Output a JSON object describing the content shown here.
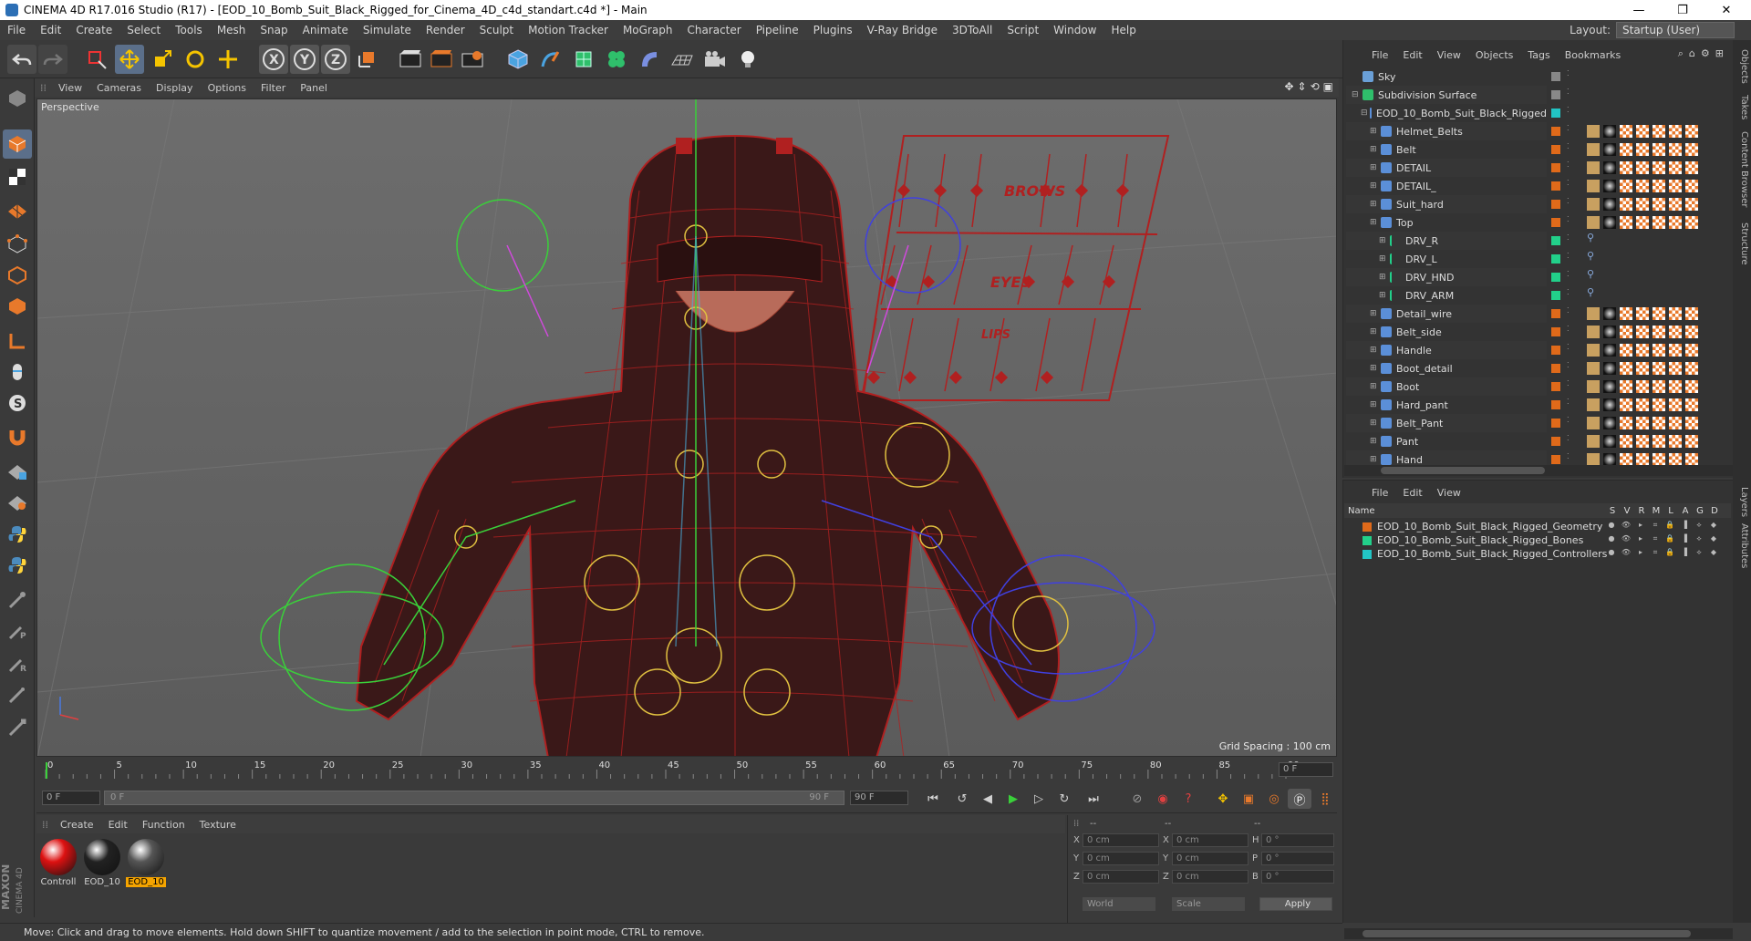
{
  "window": {
    "title": "CINEMA 4D R17.016 Studio (R17) - [EOD_10_Bomb_Suit_Black_Rigged_for_Cinema_4D_c4d_standart.c4d *] - Main",
    "min": "—",
    "max": "❐",
    "close": "✕"
  },
  "menu": [
    "File",
    "Edit",
    "Create",
    "Select",
    "Tools",
    "Mesh",
    "Snap",
    "Animate",
    "Simulate",
    "Render",
    "Sculpt",
    "Motion Tracker",
    "MoGraph",
    "Character",
    "Pipeline",
    "Plugins",
    "V-Ray Bridge",
    "3DToAll",
    "Script",
    "Window",
    "Help"
  ],
  "layout": {
    "label": "Layout:",
    "value": "Startup (User)"
  },
  "viewport": {
    "menu": [
      "View",
      "Cameras",
      "Display",
      "Options",
      "Filter",
      "Panel"
    ],
    "label": "Perspective",
    "grid": "Grid Spacing : 100 cm",
    "sign_words": [
      "BROWS",
      "EYES",
      "LIPS"
    ]
  },
  "timeline": {
    "ticks": [
      "0",
      "5",
      "10",
      "15",
      "20",
      "25",
      "30",
      "35",
      "40",
      "45",
      "50",
      "55",
      "60",
      "65",
      "70",
      "75",
      "80",
      "85",
      "90"
    ],
    "current": "0 F",
    "start": "0 F",
    "range_start": "0 F",
    "range_end": "90 F",
    "end": "90 F"
  },
  "materials": {
    "menu": [
      "Create",
      "Edit",
      "Function",
      "Texture"
    ],
    "items": [
      {
        "label": "Controll",
        "color": "#d11"
      },
      {
        "label": "EOD_10",
        "color": "#222"
      },
      {
        "label": "EOD_10",
        "color": "#555"
      }
    ]
  },
  "attributes": {
    "header": [
      "--",
      "--",
      "--"
    ],
    "rows": [
      {
        "a": "X",
        "av": "0 cm",
        "b": "X",
        "bv": "0 cm",
        "c": "H",
        "cv": "0 °"
      },
      {
        "a": "Y",
        "av": "0 cm",
        "b": "Y",
        "bv": "0 cm",
        "c": "P",
        "cv": "0 °"
      },
      {
        "a": "Z",
        "av": "0 cm",
        "b": "Z",
        "bv": "0 cm",
        "c": "B",
        "cv": "0 °"
      }
    ],
    "world": "World",
    "scale": "Scale",
    "apply": "Apply"
  },
  "status": "Move: Click and drag to move elements. Hold down SHIFT to quantize movement / add to the selection in point mode, CTRL to remove.",
  "objects": {
    "menu": [
      "File",
      "Edit",
      "View",
      "Objects",
      "Tags",
      "Bookmarks"
    ],
    "rows": [
      {
        "name": "Sky",
        "indent": 0,
        "color": "#888",
        "tags": 0
      },
      {
        "name": "Subdivision Surface",
        "indent": 0,
        "color": "#888",
        "tags": 0
      },
      {
        "name": "EOD_10_Bomb_Suit_Black_Rigged",
        "indent": 1,
        "color": "#22c4c4",
        "tags": 0
      },
      {
        "name": "Helmet_Belts",
        "indent": 2,
        "color": "#e06a1a",
        "tags": 7
      },
      {
        "name": "Belt",
        "indent": 2,
        "color": "#e06a1a",
        "tags": 7
      },
      {
        "name": "DETAIL",
        "indent": 2,
        "color": "#e06a1a",
        "tags": 7
      },
      {
        "name": "DETAIL_",
        "indent": 2,
        "color": "#e06a1a",
        "tags": 7
      },
      {
        "name": "Suit_hard",
        "indent": 2,
        "color": "#e06a1a",
        "tags": 7
      },
      {
        "name": "Top",
        "indent": 2,
        "color": "#e06a1a",
        "tags": 7
      },
      {
        "name": "DRV_R",
        "indent": 3,
        "color": "#22d08a",
        "tags": 1
      },
      {
        "name": "DRV_L",
        "indent": 3,
        "color": "#22d08a",
        "tags": 1
      },
      {
        "name": "DRV_HND",
        "indent": 3,
        "color": "#22d08a",
        "tags": 1
      },
      {
        "name": "DRV_ARM",
        "indent": 3,
        "color": "#22d08a",
        "tags": 1
      },
      {
        "name": "Detail_wire",
        "indent": 2,
        "color": "#e06a1a",
        "tags": 7
      },
      {
        "name": "Belt_side",
        "indent": 2,
        "color": "#e06a1a",
        "tags": 7
      },
      {
        "name": "Handle",
        "indent": 2,
        "color": "#e06a1a",
        "tags": 7
      },
      {
        "name": "Boot_detail",
        "indent": 2,
        "color": "#e06a1a",
        "tags": 7
      },
      {
        "name": "Boot",
        "indent": 2,
        "color": "#e06a1a",
        "tags": 7
      },
      {
        "name": "Hard_pant",
        "indent": 2,
        "color": "#e06a1a",
        "tags": 7
      },
      {
        "name": "Belt_Pant",
        "indent": 2,
        "color": "#e06a1a",
        "tags": 7
      },
      {
        "name": "Pant",
        "indent": 2,
        "color": "#e06a1a",
        "tags": 7
      },
      {
        "name": "Hand",
        "indent": 2,
        "color": "#e06a1a",
        "tags": 7
      }
    ]
  },
  "layers": {
    "menu": [
      "File",
      "Edit",
      "View"
    ],
    "header": {
      "name": "Name",
      "cols": [
        "S",
        "V",
        "R",
        "M",
        "L",
        "A",
        "G",
        "D"
      ]
    },
    "rows": [
      {
        "name": "EOD_10_Bomb_Suit_Black_Rigged_Geometry",
        "color": "#e06a1a"
      },
      {
        "name": "EOD_10_Bomb_Suit_Black_Rigged_Bones",
        "color": "#22d08a"
      },
      {
        "name": "EOD_10_Bomb_Suit_Black_Rigged_Controllers",
        "color": "#22c4c4"
      }
    ]
  },
  "sidetabs": [
    "Objects",
    "Takes",
    "Content Browser",
    "Structure",
    "Layers",
    "Attributes"
  ]
}
